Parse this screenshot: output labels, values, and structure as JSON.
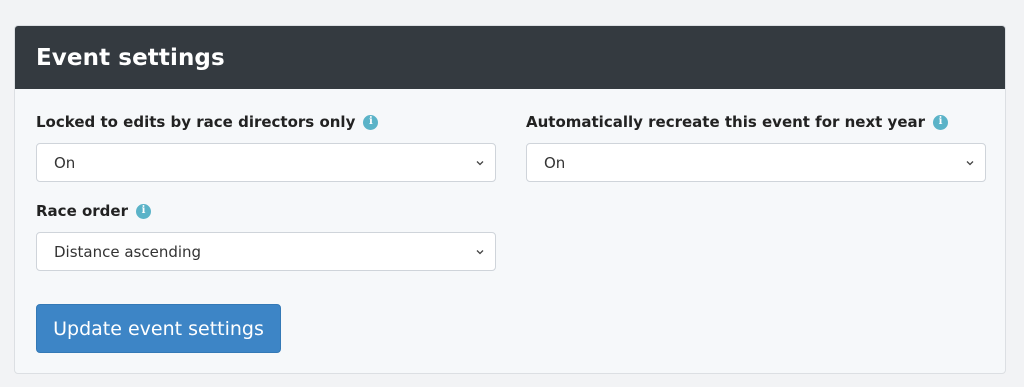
{
  "card": {
    "title": "Event settings"
  },
  "fields": {
    "locked": {
      "label": "Locked to edits by race directors only",
      "value": "On",
      "info_icon": "info-icon"
    },
    "recreate": {
      "label": "Automatically recreate this event for next year",
      "value": "On",
      "info_icon": "info-icon"
    },
    "race_order": {
      "label": "Race order",
      "value": "Distance ascending",
      "info_icon": "info-icon"
    }
  },
  "actions": {
    "submit_label": "Update event settings"
  },
  "icons": {
    "info_glyph": "i",
    "select_chevron": "chevron-down-icon"
  },
  "colors": {
    "header_bg": "#343a40",
    "primary_button": "#3d85c6",
    "info_icon": "#5bb3c8"
  }
}
